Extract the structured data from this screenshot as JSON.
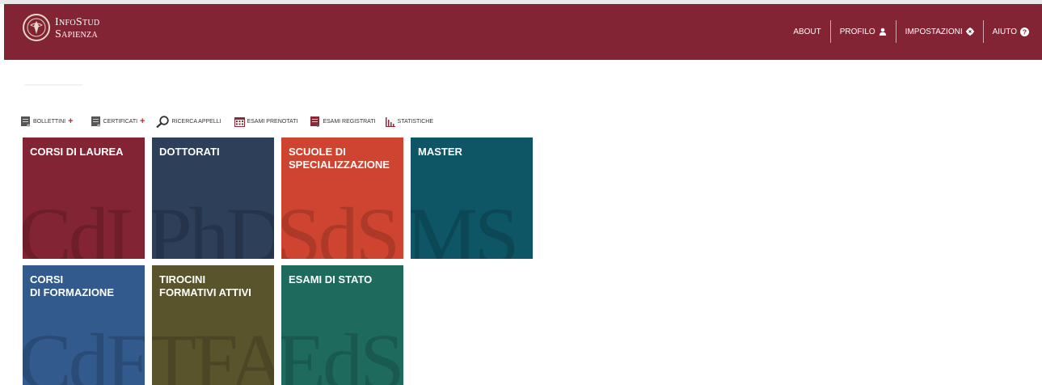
{
  "header": {
    "brand_line1": "InfoStud",
    "brand_line2": "Sapienza",
    "nav": [
      {
        "label": "ABOUT",
        "icon": ""
      },
      {
        "label": "PROFILO",
        "icon": "user-icon"
      },
      {
        "label": "IMPOSTAZIONI",
        "icon": "gear-icon"
      },
      {
        "label": "AIUTO",
        "icon": "help-circle-icon"
      }
    ]
  },
  "toolbar": [
    {
      "label": "BOLLETTINI",
      "icon": "document-icon",
      "plus": "+"
    },
    {
      "label": "CERTIFICATI",
      "icon": "document-icon",
      "plus": "+"
    },
    {
      "label": "RICERCA APPELLI",
      "icon": "search-icon",
      "plus": ""
    },
    {
      "label": "ESAMI PRENOTATI",
      "icon": "calendar-icon",
      "plus": ""
    },
    {
      "label": "ESAMI REGISTRATI",
      "icon": "document-red-icon",
      "plus": ""
    },
    {
      "label": "STATISTICHE",
      "icon": "bar-chart-icon",
      "plus": ""
    }
  ],
  "tiles": [
    {
      "title": "CORSI DI LAUREA",
      "abbr": "CdL",
      "color": "#822433"
    },
    {
      "title": "DOTTORATI",
      "abbr": "PhD",
      "color": "#2e3f5a"
    },
    {
      "title": "SCUOLE DI\nSPECIALIZZAZIONE",
      "abbr": "SdS",
      "color": "#cf4430"
    },
    {
      "title": "MASTER",
      "abbr": "MS",
      "color": "#0e5565"
    },
    {
      "title": "CORSI\nDI FORMAZIONE",
      "abbr": "CdF",
      "color": "#325a8c"
    },
    {
      "title": "TIROCINI\nFORMATIVI ATTIVI",
      "abbr": "TFA",
      "color": "#5a542d"
    },
    {
      "title": "ESAMI DI STATO",
      "abbr": "EdS",
      "color": "#1e6b5e"
    }
  ],
  "colors": {
    "brand": "#822433",
    "plus": "#c0272d"
  }
}
